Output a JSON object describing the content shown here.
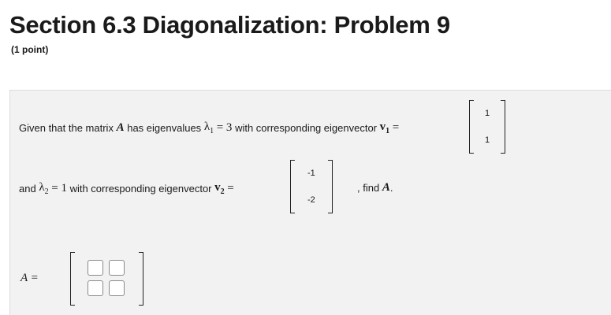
{
  "header": {
    "title": "Section 6.3 Diagonalization: Problem 9",
    "points": "(1 point)"
  },
  "problem": {
    "line1_text_a": "Given that the matrix",
    "matrix_symbol": "A",
    "line1_text_b": "has eigenvalues",
    "lambda1": "λ",
    "lambda1_sub": "1",
    "lambda1_eq": "= 3",
    "line1_text_c": "with corresponding eigenvector",
    "v1": "v",
    "v1_sub": "1",
    "v1_eq": "=",
    "v1_entries": [
      "1",
      "1"
    ],
    "line2_text_a": "and",
    "lambda2": "λ",
    "lambda2_sub": "2",
    "lambda2_eq": "= 1",
    "line2_text_b": "with corresponding eigenvector",
    "v2": "v",
    "v2_sub": "2",
    "v2_eq": "=",
    "v2_entries": [
      "-1",
      "-2"
    ],
    "line2_text_c": ", find",
    "find_symbol": "A",
    "find_period": ".",
    "answer_label": "A =",
    "answer_cells": [
      "",
      "",
      "",
      ""
    ]
  }
}
